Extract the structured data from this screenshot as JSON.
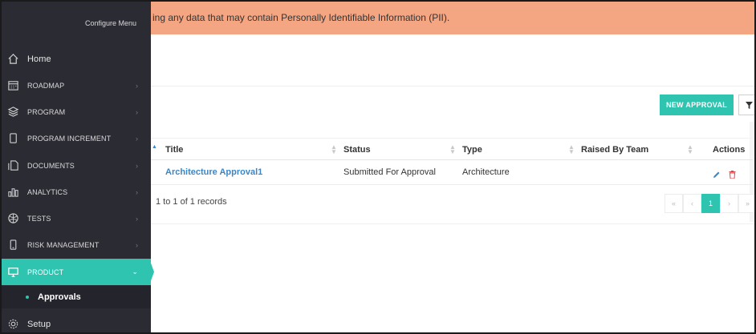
{
  "banner": {
    "text": "ing any data that may contain Personally Identifiable Information (PII)."
  },
  "sidebar": {
    "configure_label": "Configure Menu",
    "items": [
      {
        "label": "Home",
        "icon": "home-icon"
      },
      {
        "label": "ROADMAP",
        "icon": "calendar-icon"
      },
      {
        "label": "PROGRAM",
        "icon": "layers-icon"
      },
      {
        "label": "PROGRAM INCREMENT",
        "icon": "column-icon"
      },
      {
        "label": "DOCUMENTS",
        "icon": "documents-icon"
      },
      {
        "label": "ANALYTICS",
        "icon": "bar-chart-icon"
      },
      {
        "label": "TESTS",
        "icon": "globe-icon"
      },
      {
        "label": "RISK MANAGEMENT",
        "icon": "mobile-icon"
      },
      {
        "label": "PRODUCT",
        "icon": "monitor-icon"
      },
      {
        "label": "Setup",
        "icon": "gear-icon"
      }
    ],
    "sub_item": {
      "label": "Approvals"
    },
    "chevron": "›",
    "chevron_open": "⌄"
  },
  "toolbar": {
    "new_approval_label": "NEW APPROVAL"
  },
  "table": {
    "headers": [
      "Title",
      "Status",
      "Type",
      "Raised By Team",
      "Actions"
    ],
    "rows": [
      {
        "title": "Architecture Approval1",
        "status": "Submitted For Approval",
        "type": "Architecture",
        "team": ""
      }
    ]
  },
  "footer": {
    "records_text": "1 to 1 of 1 records"
  },
  "pagination": {
    "first": "«",
    "prev": "‹",
    "current": "1",
    "next": "›",
    "last": "»"
  },
  "colors": {
    "accent": "#2ec4b0",
    "banner": "#f4a582",
    "sidebar": "#2b2b34",
    "link": "#3a86c8",
    "delete": "#e0434a"
  }
}
